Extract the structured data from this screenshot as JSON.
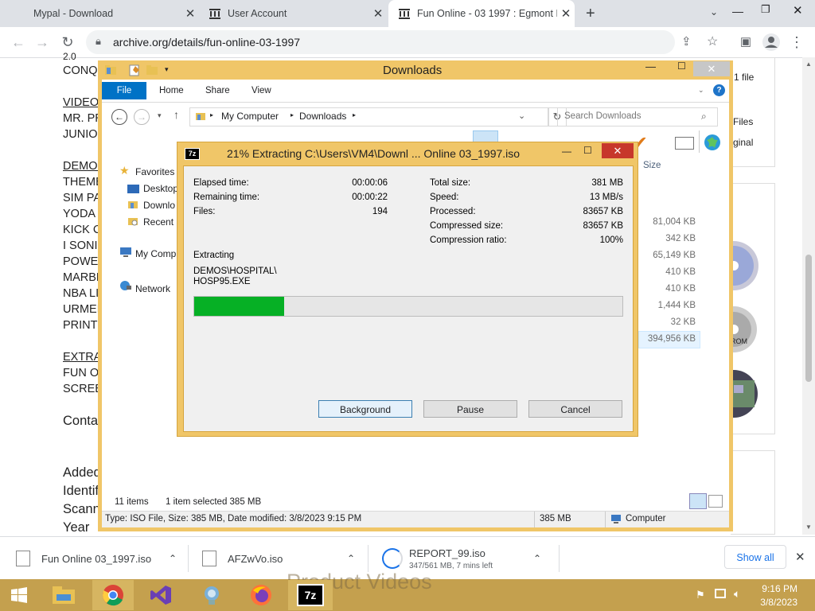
{
  "browser": {
    "tabs": [
      {
        "title": "Mypal - Download"
      },
      {
        "title": "User Account"
      },
      {
        "title": "Fun Online - 03 1997 : Egmont In"
      }
    ],
    "url": "archive.org/details/fun-online-03-1997"
  },
  "page": {
    "left_lines": [
      "2.0",
      "CONQ",
      "VIDEO",
      "MR. PR",
      "JUNIOR",
      "DEMOS",
      "THEME",
      "SIM PA",
      "YODA",
      "KICK C",
      "I SONIC",
      "POWE",
      "MARBL",
      "NBA LI",
      "URMEL",
      "PRINT",
      "EXTRA",
      "FUN O",
      "SCREE",
      "Conta",
      "Added",
      "Identif",
      "Scann",
      "Year"
    ],
    "right_texts": {
      "files_count": "1 file",
      "files_label": "Files",
      "original": "ginal"
    },
    "right_sizes": [
      "81,004 KB",
      "342 KB",
      "65,149 KB",
      "410 KB",
      "410 KB",
      "1,444 KB",
      "32 KB",
      "394,956 KB"
    ],
    "size_header": "Size",
    "bottom_text": "Product Videos"
  },
  "explorer": {
    "title": "Downloads",
    "ribbon_tabs": [
      "File",
      "Home",
      "Share",
      "View"
    ],
    "breadcrumb": [
      "My Computer",
      "Downloads"
    ],
    "search_placeholder": "Search Downloads",
    "nav": [
      "Favorites",
      "Desktop",
      "Downlo",
      "Recent p",
      "My Comp",
      "Network"
    ],
    "status_items": "11 items",
    "status_selected": "1 item selected  385 MB",
    "details_info": "Type: ISO File, Size: 385 MB, Date modified: 3/8/2023 9:15 PM",
    "details_size": "385 MB",
    "details_location": "Computer"
  },
  "dialog": {
    "title": "21% Extracting C:\\Users\\VM4\\Downl ... Online 03_1997.iso",
    "elapsed_label": "Elapsed time:",
    "elapsed": "00:00:06",
    "remaining_label": "Remaining time:",
    "remaining": "00:00:22",
    "files_label": "Files:",
    "files": "194",
    "total_label": "Total size:",
    "total": "381 MB",
    "speed_label": "Speed:",
    "speed": "13 MB/s",
    "processed_label": "Processed:",
    "processed": "83657 KB",
    "compressed_label": "Compressed size:",
    "compressed": "83657 KB",
    "ratio_label": "Compression ratio:",
    "ratio": "100%",
    "action": "Extracting",
    "path1": "DEMOS\\HOSPITAL\\",
    "path2": "HOSP95.EXE",
    "progress": 0.21,
    "btn_background": "Background",
    "btn_pause": "Pause",
    "btn_cancel": "Cancel"
  },
  "downloads": {
    "items": [
      {
        "name": "Fun Online 03_1997.iso",
        "sub": ""
      },
      {
        "name": "AFZwVo.iso",
        "sub": ""
      },
      {
        "name": "REPORT_99.iso",
        "sub": "347/561 MB, 7 mins left"
      }
    ],
    "show_all": "Show all"
  },
  "taskbar": {
    "time": "9:16 PM",
    "date": "3/8/2023"
  },
  "colors": {
    "accent": "#0072c6",
    "window_frame": "#f0c668",
    "progress": "#06b025",
    "close": "#c7372b"
  }
}
